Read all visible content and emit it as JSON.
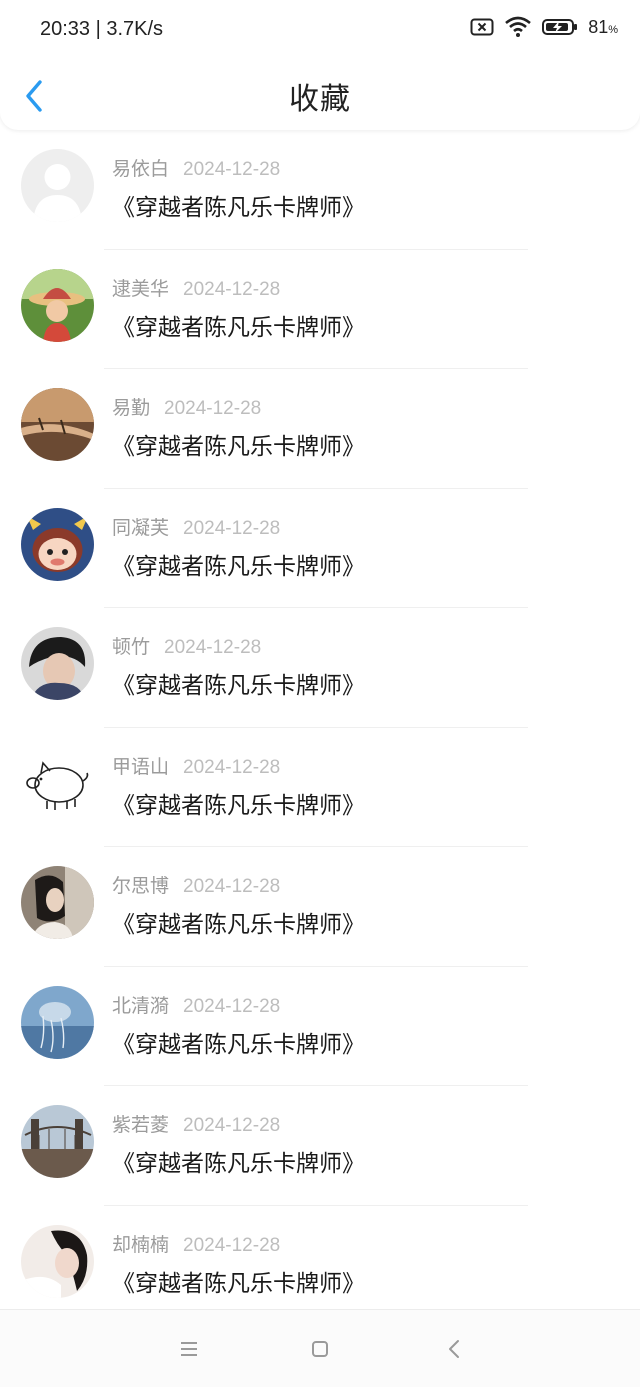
{
  "status_bar": {
    "time": "20:33 | 3.7K/s",
    "battery": "81",
    "battery_unit": "%"
  },
  "header": {
    "title": "收藏",
    "back_icon": "chevron-left-icon"
  },
  "accent": "#2a9bf0",
  "favorites": [
    {
      "name": "易依白",
      "date": "2024-12-28",
      "book": "《穿越者陈凡乐卡牌师》",
      "avatar": "default-avatar"
    },
    {
      "name": "逮美华",
      "date": "2024-12-28",
      "book": "《穿越者陈凡乐卡牌师》",
      "avatar": "girl-hat-photo"
    },
    {
      "name": "易勤",
      "date": "2024-12-28",
      "book": "《穿越者陈凡乐卡牌师》",
      "avatar": "thorn-branch-photo"
    },
    {
      "name": "同凝芙",
      "date": "2024-12-28",
      "book": "《穿越者陈凡乐卡牌师》",
      "avatar": "cartoon-bull"
    },
    {
      "name": "顿竹",
      "date": "2024-12-28",
      "book": "《穿越者陈凡乐卡牌师》",
      "avatar": "boy-photo"
    },
    {
      "name": "甲语山",
      "date": "2024-12-28",
      "book": "《穿越者陈凡乐卡牌师》",
      "avatar": "pig-sketch"
    },
    {
      "name": "尔思博",
      "date": "2024-12-28",
      "book": "《穿越者陈凡乐卡牌师》",
      "avatar": "girl-profile-photo"
    },
    {
      "name": "北清漪",
      "date": "2024-12-28",
      "book": "《穿越者陈凡乐卡牌师》",
      "avatar": "jellyfish-photo"
    },
    {
      "name": "紫若菱",
      "date": "2024-12-28",
      "book": "《穿越者陈凡乐卡牌师》",
      "avatar": "bridge-photo"
    },
    {
      "name": "却楠楠",
      "date": "2024-12-28",
      "book": "《穿越者陈凡乐卡牌师》",
      "avatar": "girl-selfie-photo"
    }
  ],
  "nav": {
    "menu_icon": "menu-icon",
    "home_icon": "home-square-icon",
    "back_icon": "back-triangle-icon"
  }
}
